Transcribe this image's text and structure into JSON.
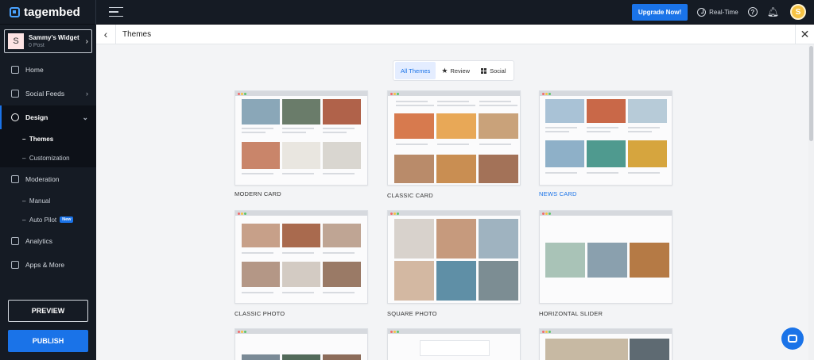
{
  "app": {
    "logo_text": "tagembed"
  },
  "topbar": {
    "upgrade_label": "Upgrade Now!",
    "realtime_label": "Real-Time",
    "help_icon": "help-circle-icon",
    "bell_icon": "bell-icon",
    "avatar_letter": "S"
  },
  "widget": {
    "avatar_letter": "S",
    "name": "Sammy's Widget",
    "posts": "0 Post"
  },
  "sidebar": {
    "home": "Home",
    "social_feeds": "Social Feeds",
    "design": "Design",
    "themes": "Themes",
    "customization": "Customization",
    "moderation": "Moderation",
    "manual": "Manual",
    "auto_pilot": "Auto Pilot",
    "new_badge": "New",
    "analytics": "Analytics",
    "apps_more": "Apps & More",
    "preview": "PREVIEW",
    "publish": "PUBLISH"
  },
  "header": {
    "title": "Themes"
  },
  "tabs": {
    "all": "All Themes",
    "review": "Review",
    "social": "Social",
    "active": "All Themes"
  },
  "themes": [
    {
      "name": "MODERN CARD",
      "selected": false
    },
    {
      "name": "CLASSIC CARD",
      "selected": false
    },
    {
      "name": "NEWS CARD",
      "selected": true
    },
    {
      "name": "CLASSIC PHOTO",
      "selected": false
    },
    {
      "name": "SQUARE PHOTO",
      "selected": false
    },
    {
      "name": "HORIZONTAL SLIDER",
      "selected": false
    }
  ],
  "colors": {
    "accent": "#1a73e8",
    "sidebar_bg": "#151b24"
  }
}
